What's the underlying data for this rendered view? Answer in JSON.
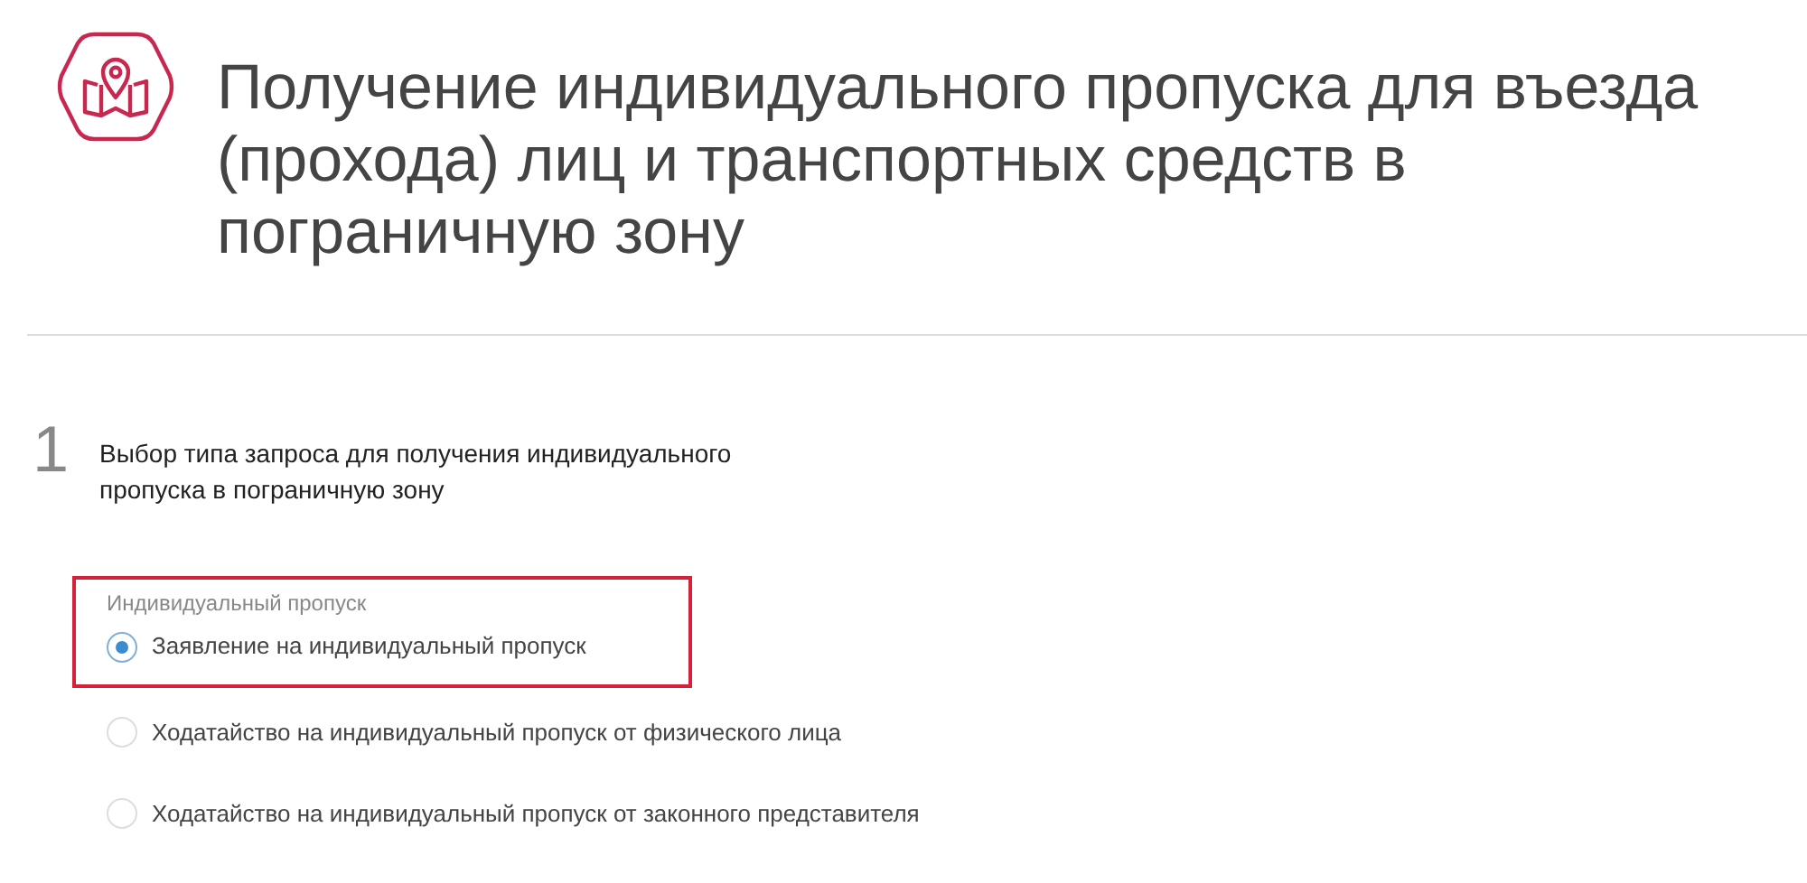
{
  "header": {
    "title": "Получение индивидуального пропуска для въезда (прохода) лиц и транспортных средств в пограничную зону"
  },
  "step": {
    "number": "1",
    "title": "Выбор типа запроса для получения индивидуального пропуска в пограничную зону"
  },
  "option_groups": [
    {
      "label": "Индивидуальный пропуск",
      "highlighted": true,
      "options": [
        {
          "label": "Заявление на индивидуальный пропуск",
          "selected": true
        }
      ]
    },
    {
      "highlighted": false,
      "options": [
        {
          "label": "Ходатайство на индивидуальный пропуск от физического лица",
          "selected": false
        },
        {
          "label": "Ходатайство на индивидуальный пропуск от законного представителя",
          "selected": false
        }
      ]
    }
  ]
}
